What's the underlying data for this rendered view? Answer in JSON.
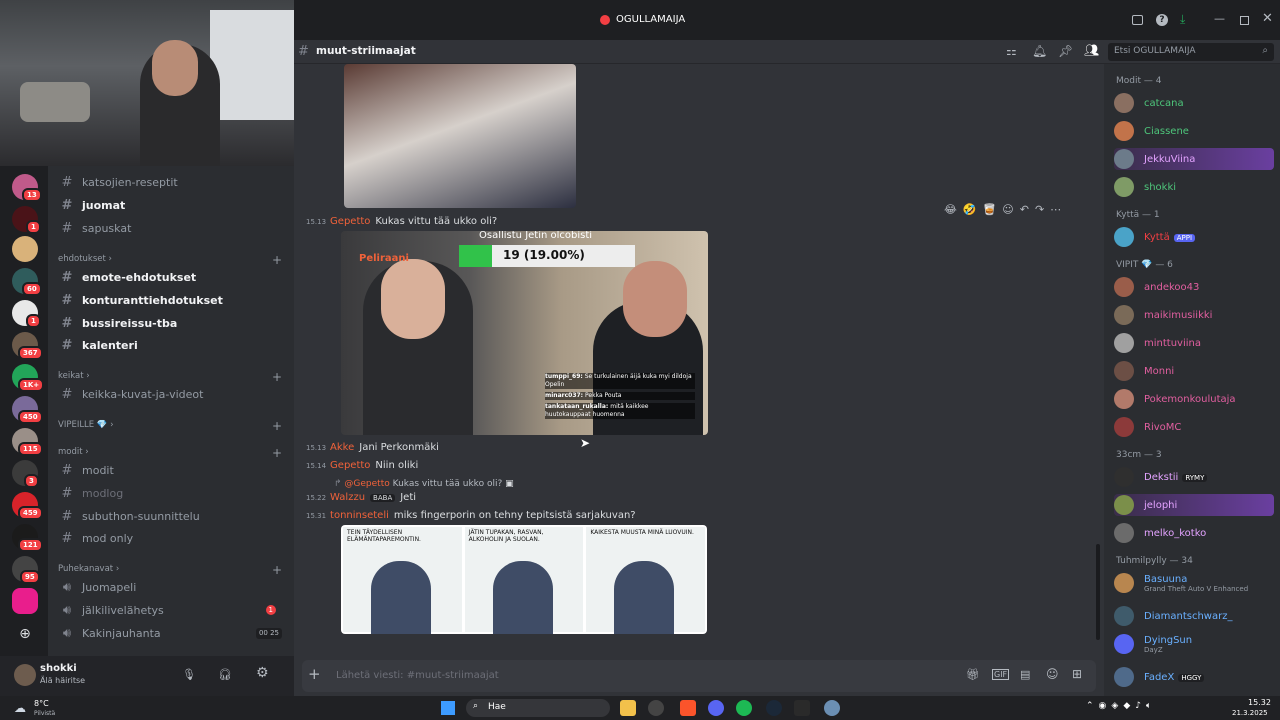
{
  "server_name": "OGULLAMAIJA",
  "channel_header": {
    "name": "muut-striimaajat",
    "search_placeholder": "Etsi OGULLAMAIJA"
  },
  "guild_badges": [
    "13",
    "1",
    "60",
    "1",
    "367",
    "1K+",
    "450",
    "115",
    "3",
    "459",
    "121",
    "95"
  ],
  "channels_top": [
    {
      "name": "katsojien-reseptit",
      "unread": false
    },
    {
      "name": "juomat",
      "unread": true
    },
    {
      "name": "sapuskat",
      "unread": false
    }
  ],
  "categories": {
    "ehdotukset": "ehdotukset",
    "keikat": "keikat",
    "vipeille": "VIPEILLE 💎",
    "modit": "modit",
    "puhekanavat": "Puhekanavat"
  },
  "ehdotukset_channels": [
    "emote-ehdotukset",
    "konturanttiehdotukset",
    "bussireissu-tba",
    "kalenteri"
  ],
  "keikat_channels": [
    "keikka-kuvat-ja-videot"
  ],
  "modit_channels": [
    "modit",
    "modlog",
    "subuthon-suunnittelu",
    "mod only"
  ],
  "voice_channels": [
    {
      "name": "Juomapeli",
      "badge": ""
    },
    {
      "name": "jälkilivelähetys",
      "badge": "1"
    },
    {
      "name": "Kakinjauhanta",
      "badge": "00 25"
    }
  ],
  "user": {
    "name": "shokki",
    "status": "Älä häiritse"
  },
  "messages": [
    {
      "time": "15.13",
      "author": "Gepetto",
      "color": "#f0623a",
      "text": "Kukas vittu tää ukko oli?"
    },
    {
      "time": "15.13",
      "author": "Akke",
      "color": "#f0623a",
      "text": "Jani Perkonmäki"
    },
    {
      "time": "15.14",
      "author": "Gepetto",
      "color": "#f0623a",
      "text": "Niin oliki"
    },
    {
      "time": "15.22",
      "author": "Walzzu",
      "color": "#f0623a",
      "text": "Jeti"
    },
    {
      "time": "15.31",
      "author": "tonninseteli",
      "color": "#f0623a",
      "text": "miks fingerporin on tehny tepitsistä sarjakuvan?"
    }
  ],
  "reply": {
    "author": "@Gepetto",
    "text": "Kukas vittu tää ukko oli?"
  },
  "walzzu_tag": "BABA",
  "video_overlay": {
    "poll_title": "Osallistu Jetin olcobisti",
    "poll_value": "19 (19.00%)",
    "logo": "Peliraani"
  },
  "video_chat": [
    {
      "user": "tumppi_69:",
      "text": "Se turkulainen äijä kuka myi dildoja Opelin"
    },
    {
      "user": "minarc037:",
      "text": "Pekka Pouta"
    },
    {
      "user": "tankataan_rukalla:",
      "text": "mitä kaikkee huutokauppaat huomenna"
    }
  ],
  "comic": [
    "TEIN TÄYDELLISEN ELÄMÄNTAPAREMONTIN.",
    "JÄTIN TUPAKAN, RASVAN, ALKOHOLIN JA SUOLAN.",
    "KAIKESTA MUUSTA MINÄ LUOVUIN."
  ],
  "composer_placeholder": "Lähetä viesti: #muut-striimaajat",
  "member_groups": [
    {
      "title": "Modit — 4",
      "members": [
        {
          "name": "catcana",
          "color": "#4ec67b",
          "tag": ""
        },
        {
          "name": "Ciassene",
          "color": "#4ec67b",
          "tag": ""
        },
        {
          "name": "JekkuViina",
          "color": "#e3a3ff",
          "tag": ""
        },
        {
          "name": "shokki",
          "color": "#4ec67b",
          "tag": ""
        }
      ]
    },
    {
      "title": "Kyttä — 1",
      "members": [
        {
          "name": "Kyttä",
          "color": "#f23f43",
          "tag": "APPI"
        }
      ]
    },
    {
      "title": "VIPIT 💎 — 6",
      "members": [
        {
          "name": "andekoo43",
          "color": "#e25fa0",
          "tag": ""
        },
        {
          "name": "maikimusiikki",
          "color": "#e25fa0",
          "tag": ""
        },
        {
          "name": "minttuviina",
          "color": "#e25fa0",
          "tag": ""
        },
        {
          "name": "Monni",
          "color": "#e25fa0",
          "tag": ""
        },
        {
          "name": "Pokemonkoulutaja",
          "color": "#e25fa0",
          "tag": ""
        },
        {
          "name": "RivoMC",
          "color": "#e25fa0",
          "tag": ""
        }
      ]
    },
    {
      "title": "33cm — 3",
      "members": [
        {
          "name": "Dekstii",
          "color": "#e3a3ff",
          "tag": "RYMY"
        },
        {
          "name": "jelophi",
          "color": "#e3a3ff",
          "tag": ""
        },
        {
          "name": "melko_kotko",
          "color": "#e3a3ff",
          "tag": ""
        }
      ]
    },
    {
      "title": "Tuhmilpylly — 34",
      "members": [
        {
          "name": "Basuuna",
          "color": "#6ab0ff",
          "tag": "",
          "activity": "Grand Theft Auto V Enhanced"
        },
        {
          "name": "Diamantschwarz_",
          "color": "#6ab0ff",
          "tag": ""
        },
        {
          "name": "DyingSun",
          "color": "#6ab0ff",
          "tag": "",
          "activity": "DayZ"
        },
        {
          "name": "FadeX",
          "color": "#6ab0ff",
          "tag": "HGGY"
        }
      ]
    }
  ],
  "taskbar": {
    "weather": "8°C",
    "weather_sub": "Pilvistä",
    "search": "Hae",
    "time": "15.32",
    "date": "21.3.2025"
  }
}
